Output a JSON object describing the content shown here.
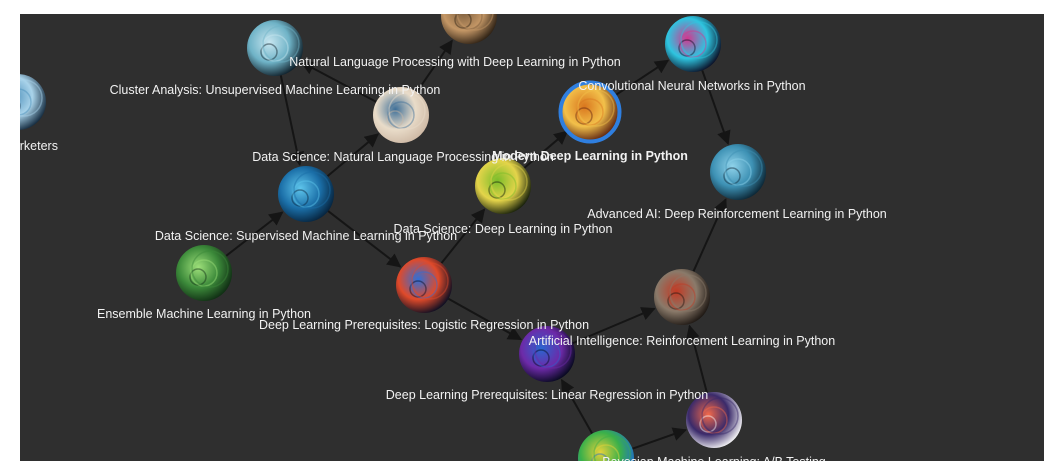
{
  "graph": {
    "nodes": [
      {
        "id": "cluster-analysis",
        "label": "Cluster Analysis: Unsupervised Machine Learning in Python",
        "colors": [
          "#0c1a24",
          "#c8e6f0",
          "#6fb3c7"
        ]
      },
      {
        "id": "nlp-deep-learning",
        "label": "Natural Language Processing with Deep Learning in Python",
        "colors": [
          "#2a1e12",
          "#7a5c3c",
          "#c49766"
        ]
      },
      {
        "id": "cnn",
        "label": "Convolutional Neural Networks in Python",
        "colors": [
          "#0a0b22",
          "#d4368f",
          "#2ec5e0"
        ]
      },
      {
        "id": "marketers",
        "label": "and Marketers",
        "colors": [
          "#10263a",
          "#4a8db8",
          "#a9d3ea"
        ]
      },
      {
        "id": "ds-nlp",
        "label": "Data Science: Natural Language Processing in Python",
        "colors": [
          "#cdb8a4",
          "#3e6f98",
          "#e9dcc9"
        ]
      },
      {
        "id": "modern-deep-learning",
        "label": "Modern Deep Learning in Python",
        "colors": [
          "#5a2010",
          "#d9761e",
          "#f2c04a"
        ],
        "highlight": true
      },
      {
        "id": "advanced-ai",
        "label": "Advanced AI: Deep Reinforcement Learning in Python",
        "colors": [
          "#0a2230",
          "#8fd2ea",
          "#3d91b4"
        ]
      },
      {
        "id": "ds-deep-learning",
        "label": "Data Science: Deep Learning in Python",
        "colors": [
          "#101a08",
          "#7bbd2a",
          "#e4d44a"
        ]
      },
      {
        "id": "ds-supervised",
        "label": "Data Science: Supervised Machine Learning in Python",
        "colors": [
          "#06213a",
          "#5ec5ec",
          "#1b6fa8"
        ]
      },
      {
        "id": "ensemble",
        "label": "Ensemble Machine Learning in Python",
        "colors": [
          "#0e2a12",
          "#9ee07a",
          "#3c8a3a"
        ]
      },
      {
        "id": "logistic-regression",
        "label": "Deep Learning Prerequisites: Logistic Regression in Python",
        "colors": [
          "#040c22",
          "#2f6fd8",
          "#e04a2a"
        ]
      },
      {
        "id": "rl",
        "label": "Artificial Intelligence: Reinforcement Learning in Python",
        "colors": [
          "#1a1410",
          "#c23a24",
          "#8a7a6a"
        ]
      },
      {
        "id": "linear-regression",
        "label": "Deep Learning Prerequisites: Linear Regression in Python",
        "colors": [
          "#03081a",
          "#2a66d0",
          "#6d2aa8"
        ]
      },
      {
        "id": "ab-testing",
        "label": "Bayesian Machine Learning: A/B Testing",
        "colors": [
          "#fafafa",
          "#f2684a",
          "#3a2a6a"
        ]
      },
      {
        "id": "bottom-node",
        "label": "",
        "colors": [
          "#1e6ad0",
          "#e6d23a",
          "#3ab04a"
        ]
      }
    ],
    "highlight_color": "#2f7fe0",
    "background": "#2f2f2f"
  }
}
